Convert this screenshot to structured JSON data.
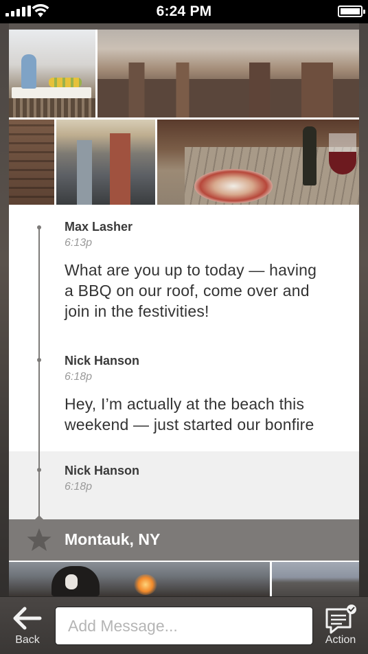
{
  "status_bar": {
    "time": "6:24 PM",
    "signal_icon": "signal-bars-icon",
    "wifi_icon": "wifi-icon",
    "battery_icon": "battery-icon",
    "battery_level": 1.0
  },
  "photos": [
    {
      "name": "rooftop-table-photo"
    },
    {
      "name": "city-skyline-photo"
    },
    {
      "name": "building-facade-photo"
    },
    {
      "name": "street-view-photo"
    },
    {
      "name": "bbq-spread-photo"
    }
  ],
  "messages": [
    {
      "sender": "Max Lasher",
      "time": "6:13p",
      "text_lines": [
        "What are you up to today — having",
        "a BBQ on our roof, come over and",
        "join in the festivities!"
      ]
    },
    {
      "sender": "Nick Hanson",
      "time": "6:18p",
      "text_lines": [
        "Hey, I’m actually at the beach this",
        "weekend — just started our bonfire"
      ]
    },
    {
      "sender": "Nick Hanson",
      "time": "6:18p"
    }
  ],
  "location": {
    "label": "Montauk, NY",
    "icon": "star-icon"
  },
  "bottom_photos": [
    {
      "name": "dog-bonfire-photo"
    },
    {
      "name": "beach-horizon-photo"
    }
  ],
  "toolbar": {
    "back_label": "Back",
    "back_icon": "back-arrow-icon",
    "input_placeholder": "Add Message...",
    "input_value": "",
    "action_label": "Action",
    "action_icon": "chat-check-icon"
  },
  "colors": {
    "location_bar": "#7d7a78",
    "timeline": "#7d7b79",
    "alt_row": "#f0f0f0"
  }
}
